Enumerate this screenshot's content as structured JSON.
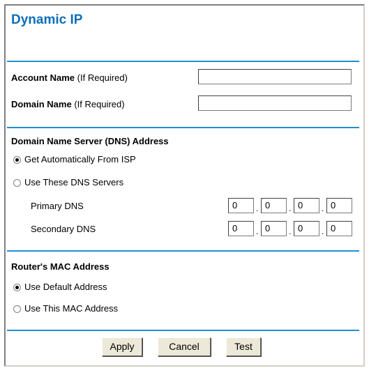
{
  "title": "Dynamic IP",
  "account": {
    "label": "Account Name",
    "suffix": "(If Required)",
    "value": ""
  },
  "domain": {
    "label": "Domain Name",
    "suffix": "(If Required)",
    "value": ""
  },
  "dns": {
    "heading": "Domain Name Server (DNS) Address",
    "option_auto": "Get Automatically From ISP",
    "option_manual": "Use These DNS Servers",
    "selected": "auto",
    "primary_label": "Primary DNS",
    "secondary_label": "Secondary DNS",
    "primary": [
      "0",
      "0",
      "0",
      "0"
    ],
    "secondary": [
      "0",
      "0",
      "0",
      "0"
    ]
  },
  "mac": {
    "heading": "Router's MAC Address",
    "option_default": "Use Default Address",
    "option_this": "Use This MAC Address",
    "selected": "default"
  },
  "buttons": {
    "apply": "Apply",
    "cancel": "Cancel",
    "test": "Test"
  },
  "colors": {
    "title": "#0c6fb8",
    "rule": "#1f8fd0"
  }
}
